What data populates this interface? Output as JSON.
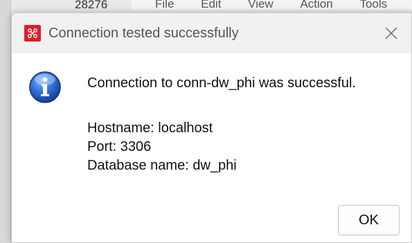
{
  "background": {
    "number": "28276",
    "menu": [
      "File",
      "Edit",
      "View",
      "Action",
      "Tools"
    ]
  },
  "dialog": {
    "title": "Connection tested successfully",
    "message": "Connection to conn-dw_phi was successful.",
    "details": [
      "Hostname: localhost",
      "Port: 3306",
      "Database name: dw_phi"
    ],
    "ok_label": "OK"
  },
  "colors": {
    "app_icon": "#d6212e",
    "info_icon": "#1f5fbf",
    "titlebar": "#f1f1f1"
  }
}
